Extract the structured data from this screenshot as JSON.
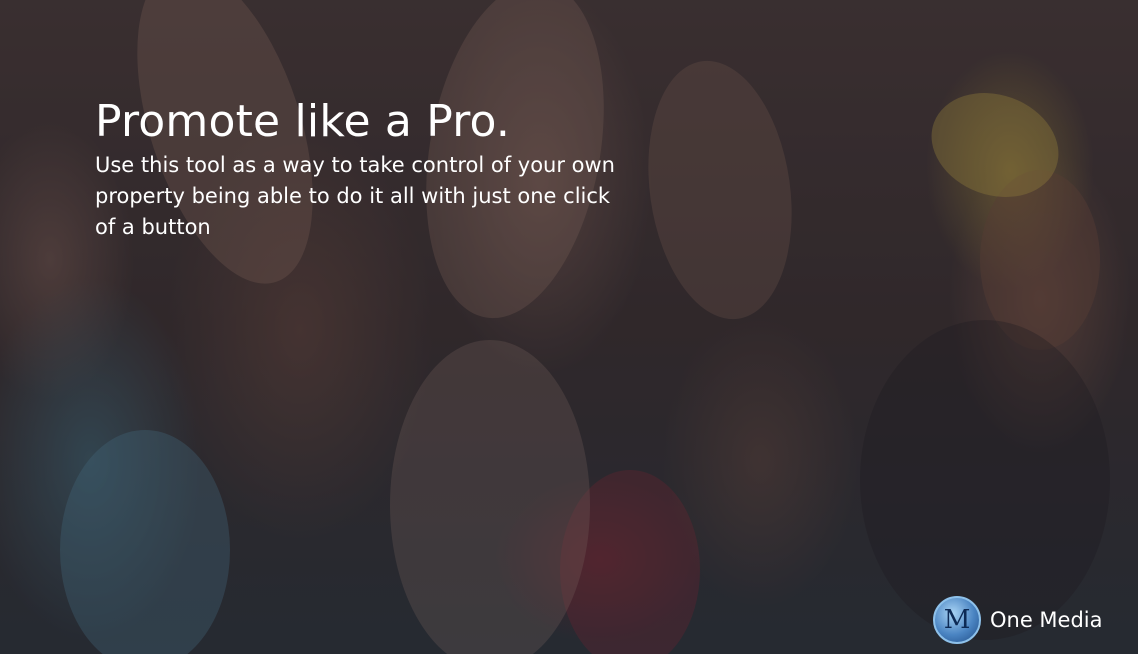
{
  "hero": {
    "headline": "Promote like a Pro.",
    "body": "Use this tool as a way to take control of your own property being able to do it all with just one click of a button"
  },
  "brand": {
    "logo_letter": "M",
    "name": "One Media"
  }
}
